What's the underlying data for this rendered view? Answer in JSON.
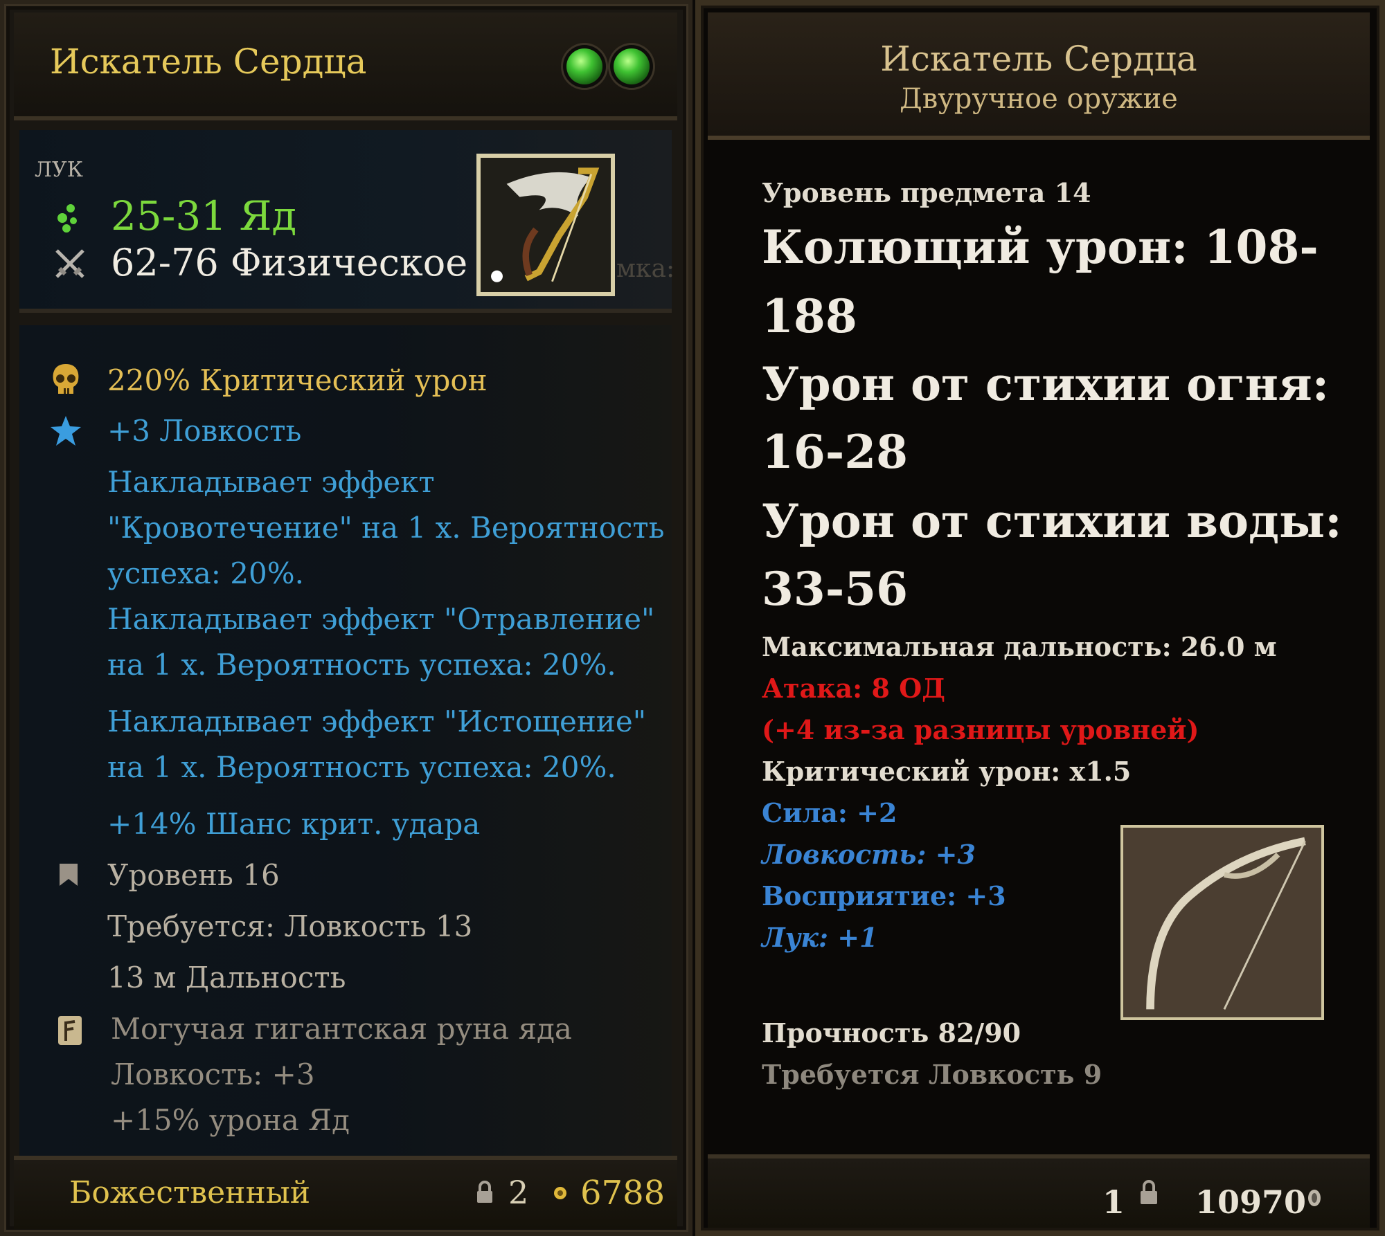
{
  "left_tooltip": {
    "title": "Искатель Сердца",
    "weapon_type": "ЛУК",
    "damage": [
      {
        "icon": "poison-icon",
        "text": "25-31 Яд",
        "color": "#7cd93d"
      },
      {
        "icon": "crossed-swords-icon",
        "text": "62-76 Физическое",
        "color": "#f0ece2"
      }
    ],
    "ghost_text": "мка:",
    "stats": {
      "crit_damage": "220%  Критический урон",
      "agility": "+3  Ловкость",
      "bleed_1": "Накладывает эффект",
      "bleed_2": "\"Кровотечение\" на 1 х. Вероятность",
      "bleed_3": "успеха: 20%.",
      "poison_1": "Накладывает эффект \"Отравление\"",
      "poison_2": "на 1 х. Вероятность успеха: 20%.",
      "exhaust_1": "Накладывает эффект \"Истощение\"",
      "exhaust_2": "на 1 х. Вероятность успеха: 20%.",
      "crit_chance": "+14%  Шанс крит. удара",
      "level": "Уровень  16",
      "requirement": "Требуется: Ловкость 13",
      "range": "13 м  Дальность",
      "rune_name": "Могучая гигантская руна яда",
      "rune_stat_1": "Ловкость: +3",
      "rune_stat_2": "+15% урона Яд"
    },
    "footer": {
      "rarity": "Божественный",
      "level": "2",
      "price": "6788"
    },
    "colors": {
      "gold": "#e4bf55",
      "blue": "#3f9fd6",
      "green": "#7cd93d"
    }
  },
  "right_tooltip": {
    "title": "Искатель Сердца",
    "subtitle": "Двуручное оружие",
    "item_level": "Уровень предмета 14",
    "pierce_1": "Колющий урон: 108-",
    "pierce_2": "188",
    "fire_1": "Урон от стихии огня:",
    "fire_2": "16-28",
    "water_1": "Урон от стихии воды:",
    "water_2": "33-56",
    "max_range": "Максимальная дальность: 26.0 м",
    "attack_cost": "Атака: 8 ОД",
    "level_diff": "(+4 из-за разницы уровней)",
    "crit": "Критический урон: x1.5",
    "strength": "Сила: +2",
    "agility": "Ловкость: +3",
    "perception": "Восприятие: +3",
    "bow": "Лук: +1",
    "durability": "Прочность 82/90",
    "requirement": "Требуется Ловкость 9",
    "footer": {
      "level": "1",
      "price": "10970"
    },
    "colors": {
      "red": "#e01818",
      "blue": "#3a84d4"
    }
  }
}
